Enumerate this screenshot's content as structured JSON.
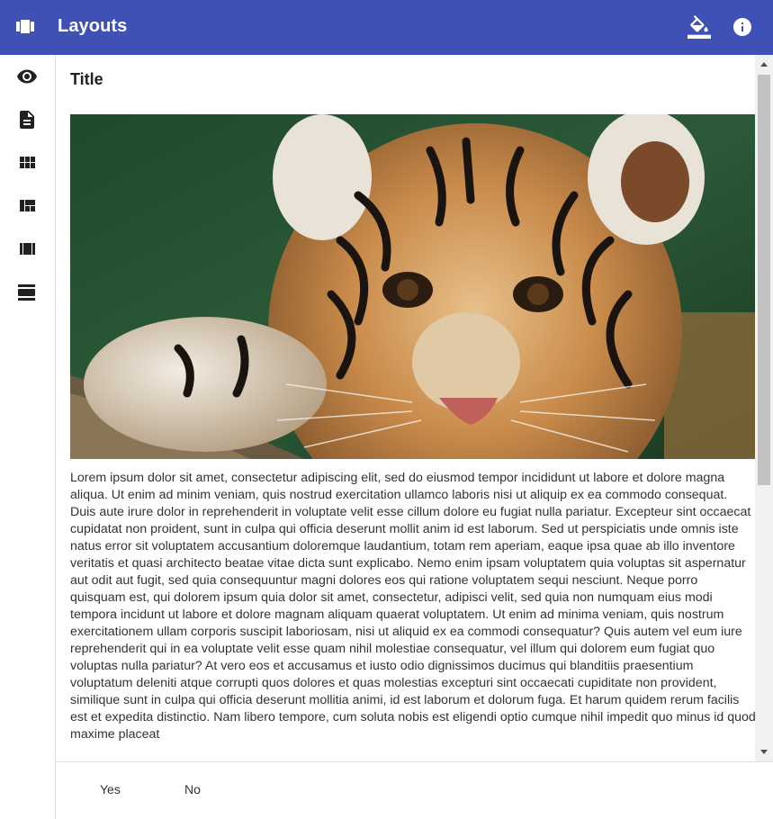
{
  "appbar": {
    "title": "Layouts",
    "icons": [
      "view-carousel-icon",
      "format-color-fill-icon",
      "info-icon"
    ],
    "background": "#3f51b5"
  },
  "sidebar": {
    "items": [
      {
        "icon": "visibility-icon"
      },
      {
        "icon": "description-icon"
      },
      {
        "icon": "view-module-icon"
      },
      {
        "icon": "view-quilt-icon"
      },
      {
        "icon": "view-array-icon"
      },
      {
        "icon": "view-day-icon"
      }
    ]
  },
  "card": {
    "title": "Title",
    "image_subject": "tiger-cub-photo",
    "body": "Lorem ipsum dolor sit amet, consectetur adipiscing elit, sed do eiusmod tempor incididunt ut labore et dolore magna aliqua. Ut enim ad minim veniam, quis nostrud exercitation ullamco laboris nisi ut aliquip ex ea commodo consequat. Duis aute irure dolor in reprehenderit in voluptate velit esse cillum dolore eu fugiat nulla pariatur. Excepteur sint occaecat cupidatat non proident, sunt in culpa qui officia deserunt mollit anim id est laborum. Sed ut perspiciatis unde omnis iste natus error sit voluptatem accusantium doloremque laudantium, totam rem aperiam, eaque ipsa quae ab illo inventore veritatis et quasi architecto beatae vitae dicta sunt explicabo. Nemo enim ipsam voluptatem quia voluptas sit aspernatur aut odit aut fugit, sed quia consequuntur magni dolores eos qui ratione voluptatem sequi nesciunt. Neque porro quisquam est, qui dolorem ipsum quia dolor sit amet, consectetur, adipisci velit, sed quia non numquam eius modi tempora incidunt ut labore et dolore magnam aliquam quaerat voluptatem. Ut enim ad minima veniam, quis nostrum exercitationem ullam corporis suscipit laboriosam, nisi ut aliquid ex ea commodi consequatur? Quis autem vel eum iure reprehenderit qui in ea voluptate velit esse quam nihil molestiae consequatur, vel illum qui dolorem eum fugiat quo voluptas nulla pariatur? At vero eos et accusamus et iusto odio dignissimos ducimus qui blanditiis praesentium voluptatum deleniti atque corrupti quos dolores et quas molestias excepturi sint occaecati cupiditate non provident, similique sunt in culpa qui officia deserunt mollitia animi, id est laborum et dolorum fuga. Et harum quidem rerum facilis est et expedita distinctio. Nam libero tempore, cum soluta nobis est eligendi optio cumque nihil impedit quo minus id quod maxime placeat"
  },
  "actions": {
    "yes_label": "Yes",
    "no_label": "No"
  }
}
